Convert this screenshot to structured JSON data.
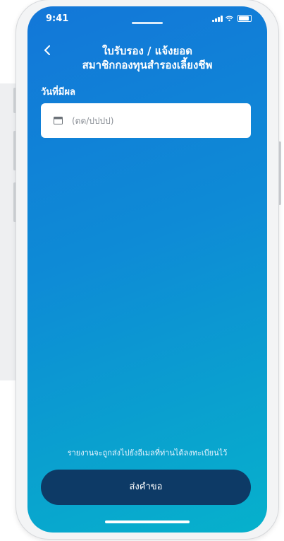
{
  "status_bar": {
    "time": "9:41"
  },
  "header": {
    "back_icon": "chevron-left-icon",
    "title_line1": "ใบรับรอง / แจ้งยอด",
    "title_line2": "สมาชิกกองทุนสำรองเลี้ยงชีพ"
  },
  "form": {
    "effective_date_label": "วันที่มีผล",
    "date_placeholder": "(ดด/ปปปป)",
    "date_icon": "calendar-icon"
  },
  "footer": {
    "notice": "รายงานจะถูกส่งไปยังอีเมลที่ท่านได้ลงทะเบียนไว้",
    "submit_label": "ส่งคำขอ"
  },
  "colors": {
    "gradient_start": "#1377d8",
    "gradient_end": "#06b1cc",
    "button": "#0d3a66"
  }
}
